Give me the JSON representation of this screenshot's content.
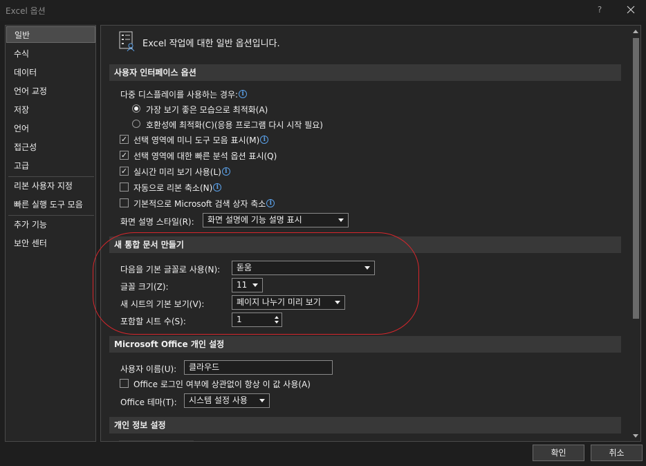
{
  "window": {
    "title": "Excel 옵션",
    "help": "?",
    "close": "✕"
  },
  "sidebar": {
    "items": [
      {
        "label": "일반"
      },
      {
        "label": "수식"
      },
      {
        "label": "데이터"
      },
      {
        "label": "언어 교정"
      },
      {
        "label": "저장"
      },
      {
        "label": "언어"
      },
      {
        "label": "접근성"
      },
      {
        "label": "고급"
      },
      {
        "label": "리본 사용자 지정"
      },
      {
        "label": "빠른 실행 도구 모음"
      },
      {
        "label": "추가 기능"
      },
      {
        "label": "보안 센터"
      }
    ]
  },
  "header": {
    "text": "Excel 작업에 대한 일반 옵션입니다."
  },
  "ui_options": {
    "section_title": "사용자 인터페이스 옵션",
    "multi_display_label": "다중 디스플레이를 사용하는 경우:",
    "radio_best": "가장 보기 좋은 모습으로 최적화(A)",
    "radio_compat": "호환성에 최적화(C)(응용 프로그램 다시 시작 필요)",
    "chk_mini_toolbar": "선택 영역에 미니 도구 모음 표시(M)",
    "chk_quick_analysis": "선택 영역에 대한 빠른 분석 옵션 표시(Q)",
    "chk_live_preview": "실시간 미리 보기 사용(L)",
    "chk_collapse_ribbon": "자동으로 리본 축소(N)",
    "chk_search_box": "기본적으로 Microsoft 검색 상자 축소",
    "tooltip_label": "화면 설명 스타일(R):",
    "tooltip_value": "화면 설명에 기능 설명 표시"
  },
  "new_workbook": {
    "section_title": "새 통합 문서 만들기",
    "font_label": "다음을 기본 글꼴로 사용(N):",
    "font_value": "돋움",
    "size_label": "글꼴 크기(Z):",
    "size_value": "11",
    "view_label": "새 시트의 기본 보기(V):",
    "view_value": "페이지 나누기 미리 보기",
    "sheets_label": "포함할 시트 수(S):",
    "sheets_value": "1"
  },
  "office_personal": {
    "section_title": "Microsoft Office 개인 설정",
    "username_label": "사용자 이름(U):",
    "username_value": "클라우드",
    "always_use_label": "Office 로그인 여부에 상관없이 항상 이 값 사용(A)",
    "theme_label": "Office 테마(T):",
    "theme_value": "시스템 설정 사용"
  },
  "privacy": {
    "section_title": "개인 정보 설정"
  },
  "buttons": {
    "ok": "확인",
    "cancel": "취소"
  },
  "colors": {
    "accent_info": "#5aa0e8",
    "highlight_ellipse": "#d8262c"
  }
}
